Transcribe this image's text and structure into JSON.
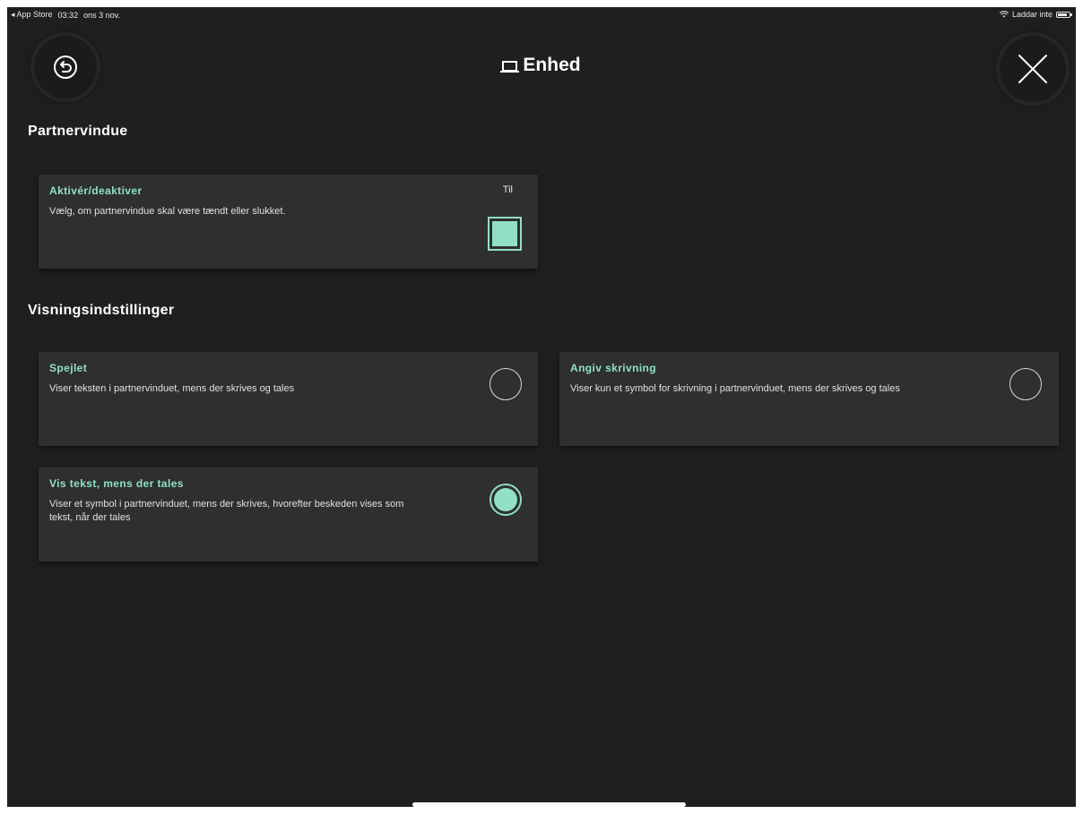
{
  "status_bar": {
    "back_app": "◂ App Store",
    "time": "03:32",
    "date": "ons 3 nov.",
    "network": "Laddar inte"
  },
  "header": {
    "title": "Enhed",
    "back_icon": "back-arrow-circle-icon",
    "close_icon": "close-x-icon"
  },
  "sections": {
    "partner_window": {
      "title": "Partnervindue",
      "toggle": {
        "title": "Aktivér/deaktiver",
        "description": "Vælg, om partnervindue skal være tændt eller slukket.",
        "status": "Til",
        "checked": true
      }
    },
    "display_settings": {
      "title": "Visningsindstillinger",
      "options": [
        {
          "title": "Spejlet",
          "description": "Viser teksten i partnervinduet, mens der skrives og tales",
          "selected": false
        },
        {
          "title": "Angiv skrivning",
          "description": "Viser kun et symbol for skrivning i partnervinduet, mens der skrives og tales",
          "selected": false
        },
        {
          "title": "Vis tekst, mens der tales",
          "description": "Viser et symbol i partnervinduet, mens der skrives, hvorefter beskeden vises som tekst, når der tales",
          "selected": true
        }
      ]
    }
  },
  "colors": {
    "background": "#1f1f1f",
    "card": "#2f2f2f",
    "accent": "#8fe0c6"
  }
}
